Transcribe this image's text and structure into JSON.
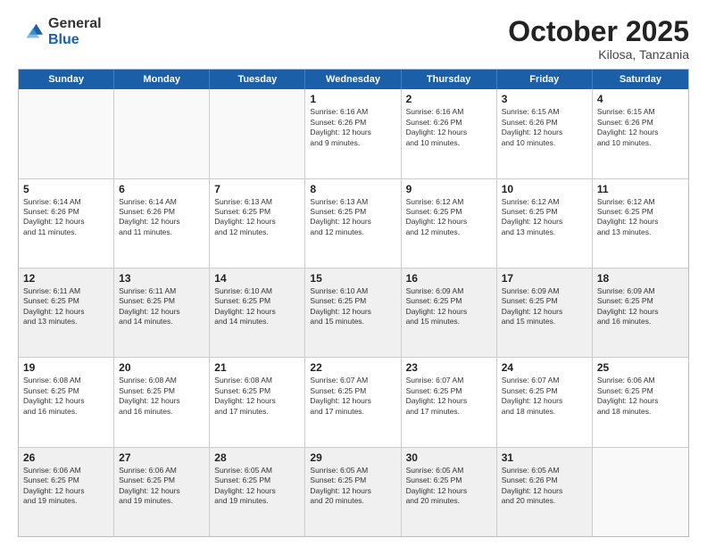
{
  "header": {
    "logo_general": "General",
    "logo_blue": "Blue",
    "month_title": "October 2025",
    "subtitle": "Kilosa, Tanzania"
  },
  "weekdays": [
    "Sunday",
    "Monday",
    "Tuesday",
    "Wednesday",
    "Thursday",
    "Friday",
    "Saturday"
  ],
  "rows": [
    [
      {
        "day": "",
        "info": "",
        "empty": true
      },
      {
        "day": "",
        "info": "",
        "empty": true
      },
      {
        "day": "",
        "info": "",
        "empty": true
      },
      {
        "day": "1",
        "info": "Sunrise: 6:16 AM\nSunset: 6:26 PM\nDaylight: 12 hours\nand 9 minutes."
      },
      {
        "day": "2",
        "info": "Sunrise: 6:16 AM\nSunset: 6:26 PM\nDaylight: 12 hours\nand 10 minutes."
      },
      {
        "day": "3",
        "info": "Sunrise: 6:15 AM\nSunset: 6:26 PM\nDaylight: 12 hours\nand 10 minutes."
      },
      {
        "day": "4",
        "info": "Sunrise: 6:15 AM\nSunset: 6:26 PM\nDaylight: 12 hours\nand 10 minutes."
      }
    ],
    [
      {
        "day": "5",
        "info": "Sunrise: 6:14 AM\nSunset: 6:26 PM\nDaylight: 12 hours\nand 11 minutes."
      },
      {
        "day": "6",
        "info": "Sunrise: 6:14 AM\nSunset: 6:26 PM\nDaylight: 12 hours\nand 11 minutes."
      },
      {
        "day": "7",
        "info": "Sunrise: 6:13 AM\nSunset: 6:25 PM\nDaylight: 12 hours\nand 12 minutes."
      },
      {
        "day": "8",
        "info": "Sunrise: 6:13 AM\nSunset: 6:25 PM\nDaylight: 12 hours\nand 12 minutes."
      },
      {
        "day": "9",
        "info": "Sunrise: 6:12 AM\nSunset: 6:25 PM\nDaylight: 12 hours\nand 12 minutes."
      },
      {
        "day": "10",
        "info": "Sunrise: 6:12 AM\nSunset: 6:25 PM\nDaylight: 12 hours\nand 13 minutes."
      },
      {
        "day": "11",
        "info": "Sunrise: 6:12 AM\nSunset: 6:25 PM\nDaylight: 12 hours\nand 13 minutes."
      }
    ],
    [
      {
        "day": "12",
        "info": "Sunrise: 6:11 AM\nSunset: 6:25 PM\nDaylight: 12 hours\nand 13 minutes.",
        "shaded": true
      },
      {
        "day": "13",
        "info": "Sunrise: 6:11 AM\nSunset: 6:25 PM\nDaylight: 12 hours\nand 14 minutes.",
        "shaded": true
      },
      {
        "day": "14",
        "info": "Sunrise: 6:10 AM\nSunset: 6:25 PM\nDaylight: 12 hours\nand 14 minutes.",
        "shaded": true
      },
      {
        "day": "15",
        "info": "Sunrise: 6:10 AM\nSunset: 6:25 PM\nDaylight: 12 hours\nand 15 minutes.",
        "shaded": true
      },
      {
        "day": "16",
        "info": "Sunrise: 6:09 AM\nSunset: 6:25 PM\nDaylight: 12 hours\nand 15 minutes.",
        "shaded": true
      },
      {
        "day": "17",
        "info": "Sunrise: 6:09 AM\nSunset: 6:25 PM\nDaylight: 12 hours\nand 15 minutes.",
        "shaded": true
      },
      {
        "day": "18",
        "info": "Sunrise: 6:09 AM\nSunset: 6:25 PM\nDaylight: 12 hours\nand 16 minutes.",
        "shaded": true
      }
    ],
    [
      {
        "day": "19",
        "info": "Sunrise: 6:08 AM\nSunset: 6:25 PM\nDaylight: 12 hours\nand 16 minutes."
      },
      {
        "day": "20",
        "info": "Sunrise: 6:08 AM\nSunset: 6:25 PM\nDaylight: 12 hours\nand 16 minutes."
      },
      {
        "day": "21",
        "info": "Sunrise: 6:08 AM\nSunset: 6:25 PM\nDaylight: 12 hours\nand 17 minutes."
      },
      {
        "day": "22",
        "info": "Sunrise: 6:07 AM\nSunset: 6:25 PM\nDaylight: 12 hours\nand 17 minutes."
      },
      {
        "day": "23",
        "info": "Sunrise: 6:07 AM\nSunset: 6:25 PM\nDaylight: 12 hours\nand 17 minutes."
      },
      {
        "day": "24",
        "info": "Sunrise: 6:07 AM\nSunset: 6:25 PM\nDaylight: 12 hours\nand 18 minutes."
      },
      {
        "day": "25",
        "info": "Sunrise: 6:06 AM\nSunset: 6:25 PM\nDaylight: 12 hours\nand 18 minutes."
      }
    ],
    [
      {
        "day": "26",
        "info": "Sunrise: 6:06 AM\nSunset: 6:25 PM\nDaylight: 12 hours\nand 19 minutes.",
        "shaded": true
      },
      {
        "day": "27",
        "info": "Sunrise: 6:06 AM\nSunset: 6:25 PM\nDaylight: 12 hours\nand 19 minutes.",
        "shaded": true
      },
      {
        "day": "28",
        "info": "Sunrise: 6:05 AM\nSunset: 6:25 PM\nDaylight: 12 hours\nand 19 minutes.",
        "shaded": true
      },
      {
        "day": "29",
        "info": "Sunrise: 6:05 AM\nSunset: 6:25 PM\nDaylight: 12 hours\nand 20 minutes.",
        "shaded": true
      },
      {
        "day": "30",
        "info": "Sunrise: 6:05 AM\nSunset: 6:25 PM\nDaylight: 12 hours\nand 20 minutes.",
        "shaded": true
      },
      {
        "day": "31",
        "info": "Sunrise: 6:05 AM\nSunset: 6:26 PM\nDaylight: 12 hours\nand 20 minutes.",
        "shaded": true
      },
      {
        "day": "",
        "info": "",
        "empty": true,
        "shaded": true
      }
    ]
  ]
}
